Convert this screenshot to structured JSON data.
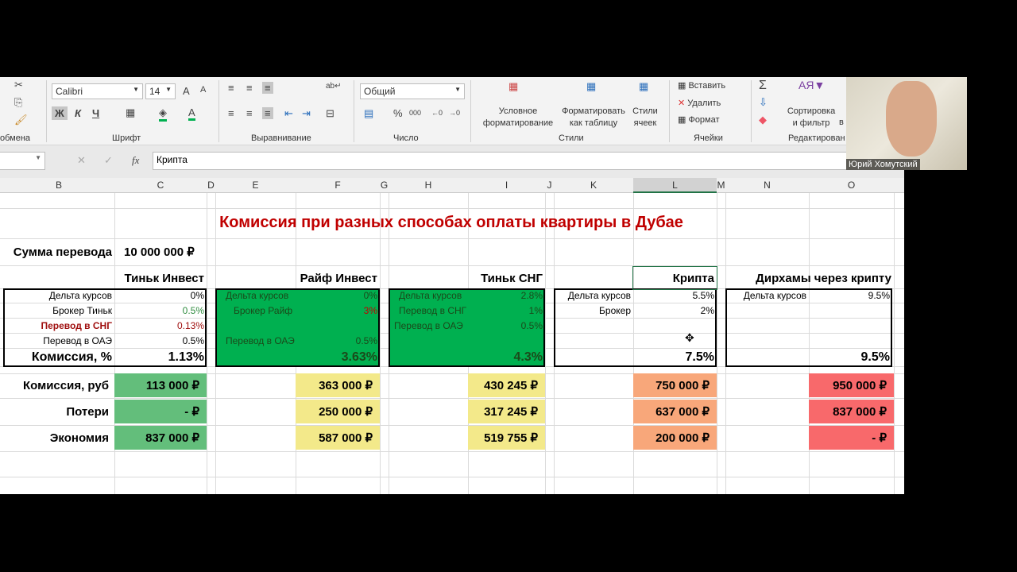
{
  "ribbon": {
    "clipboard_group": "обмена",
    "font_group": "Шрифт",
    "font_name": "Calibri",
    "font_size": "14",
    "bold": "Ж",
    "italic": "К",
    "underline": "Ч",
    "align_group": "Выравнивание",
    "number_group": "Число",
    "number_format": "Общий",
    "percent": "%",
    "thousands": "000",
    "cond_format_1": "Условное",
    "cond_format_2": "форматирование",
    "format_table_1": "Форматировать",
    "format_table_2": "как таблицу",
    "cell_styles_1": "Стили",
    "cell_styles_2": "ячеек",
    "styles_group": "Стили",
    "insert": "Вставить",
    "delete": "Удалить",
    "format": "Формат",
    "cells_group": "Ячейки",
    "sort_1": "Сортировка",
    "sort_2": "и фильтр",
    "edit_group": "Редактирован",
    "find_partial": "в"
  },
  "formula_bar": {
    "fx": "fx",
    "value": "Крипта"
  },
  "columns": [
    "B",
    "C",
    "D",
    "E",
    "F",
    "G",
    "H",
    "I",
    "J",
    "K",
    "L",
    "M",
    "N",
    "O"
  ],
  "sheet": {
    "title": "Комиссия при разных способах оплаты квартиры в Дубае",
    "amount_label": "Сумма перевода",
    "amount": "10 000 000 ₽",
    "tinkoff_invest": {
      "header": "Тиньк Инвест",
      "rows": [
        [
          "Дельта курсов",
          "0%"
        ],
        [
          "Брокер Тиньк",
          "0.5%"
        ],
        [
          "Перевод в СНГ",
          "0.13%"
        ],
        [
          "Перевод в ОАЭ",
          "0.5%"
        ]
      ],
      "total_label": "Комиссия, %",
      "total": "1.13%"
    },
    "raif_invest": {
      "header": "Райф Инвест",
      "rows": [
        [
          "Дельта курсов",
          "0%"
        ],
        [
          "Брокер Райф",
          "3%"
        ],
        [
          "Перевод в ОАЭ",
          "0.5%"
        ]
      ],
      "total": "3.63%"
    },
    "tinkoff_cis": {
      "header": "Тиньк СНГ",
      "rows": [
        [
          "Дельта курсов",
          "2.8%"
        ],
        [
          "Перевод в СНГ",
          "1%"
        ],
        [
          "Перевод в ОАЭ",
          "0.5%"
        ]
      ],
      "total": "4.3%"
    },
    "crypto": {
      "header": "Крипта",
      "rows": [
        [
          "Дельта курсов",
          "5.5%"
        ],
        [
          "Брокер",
          "2%"
        ]
      ],
      "total": "7.5%"
    },
    "dirhams": {
      "header": "Дирхамы через крипту",
      "rows": [
        [
          "Дельта курсов",
          "9.5%"
        ]
      ],
      "total": "9.5%"
    },
    "summary": {
      "labels": [
        "Комиссия, руб",
        "Потери",
        "Экономия"
      ],
      "tinkoff_invest": [
        "113 000 ₽",
        "-     ₽",
        "837 000 ₽"
      ],
      "raif_invest": [
        "363 000 ₽",
        "250 000 ₽",
        "587 000 ₽"
      ],
      "tinkoff_cis": [
        "430 245 ₽",
        "317 245 ₽",
        "519 755 ₽"
      ],
      "crypto": [
        "750 000 ₽",
        "637 000 ₽",
        "200 000 ₽"
      ],
      "dirhams": [
        "950 000 ₽",
        "837 000 ₽",
        "-     ₽"
      ]
    }
  },
  "video": {
    "participant": "Юрий Хомутский"
  },
  "colors": {
    "green": "#00b050",
    "title_red": "#c00000",
    "tink_green": "#63be7b",
    "yellow": "#f3e98a",
    "orange": "#f8a77a",
    "red": "#f8696b"
  }
}
